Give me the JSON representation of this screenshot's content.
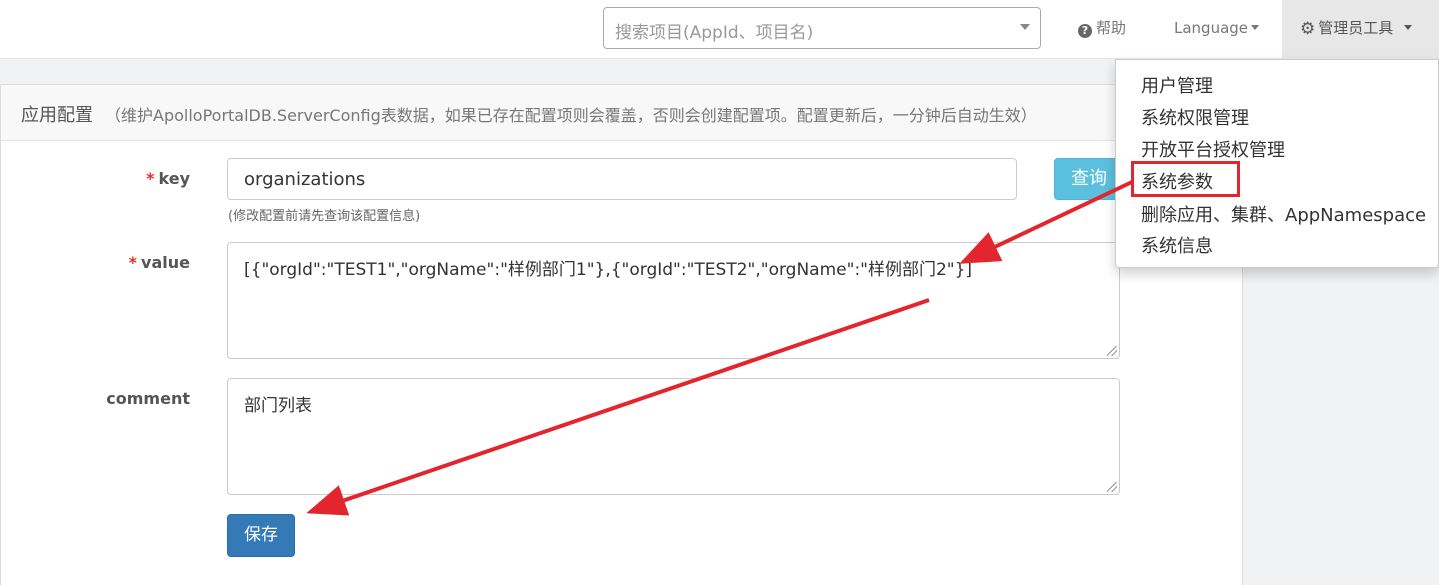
{
  "navbar": {
    "search_placeholder": "搜索项目(AppId、项目名)",
    "help_label": "帮助",
    "language_label": "Language",
    "admin_label": "管理员工具"
  },
  "admin_menu": {
    "items": [
      "用户管理",
      "系统权限管理",
      "开放平台授权管理",
      "系统参数",
      "删除应用、集群、AppNamespace",
      "系统信息"
    ],
    "highlighted": "系统参数"
  },
  "panel": {
    "title": "应用配置",
    "description": "（维护ApolloPortalDB.ServerConfig表数据，如果已存在配置项则会覆盖，否则会创建配置项。配置更新后，一分钟后自动生效）"
  },
  "form": {
    "required_mark": "*",
    "key_label": "key",
    "key_value": "organizations",
    "key_help": "(修改配置前请先查询该配置信息)",
    "query_button": "查询",
    "value_label": "value",
    "value_value": "[{\"orgId\":\"TEST1\",\"orgName\":\"样例部门1\"},{\"orgId\":\"TEST2\",\"orgName\":\"样例部门2\"}]",
    "comment_label": "comment",
    "comment_value": "部门列表",
    "save_button": "保存"
  },
  "colors": {
    "annotation_red": "#e3252d",
    "primary_button": "#337ab7",
    "info_button": "#5bc0de"
  }
}
